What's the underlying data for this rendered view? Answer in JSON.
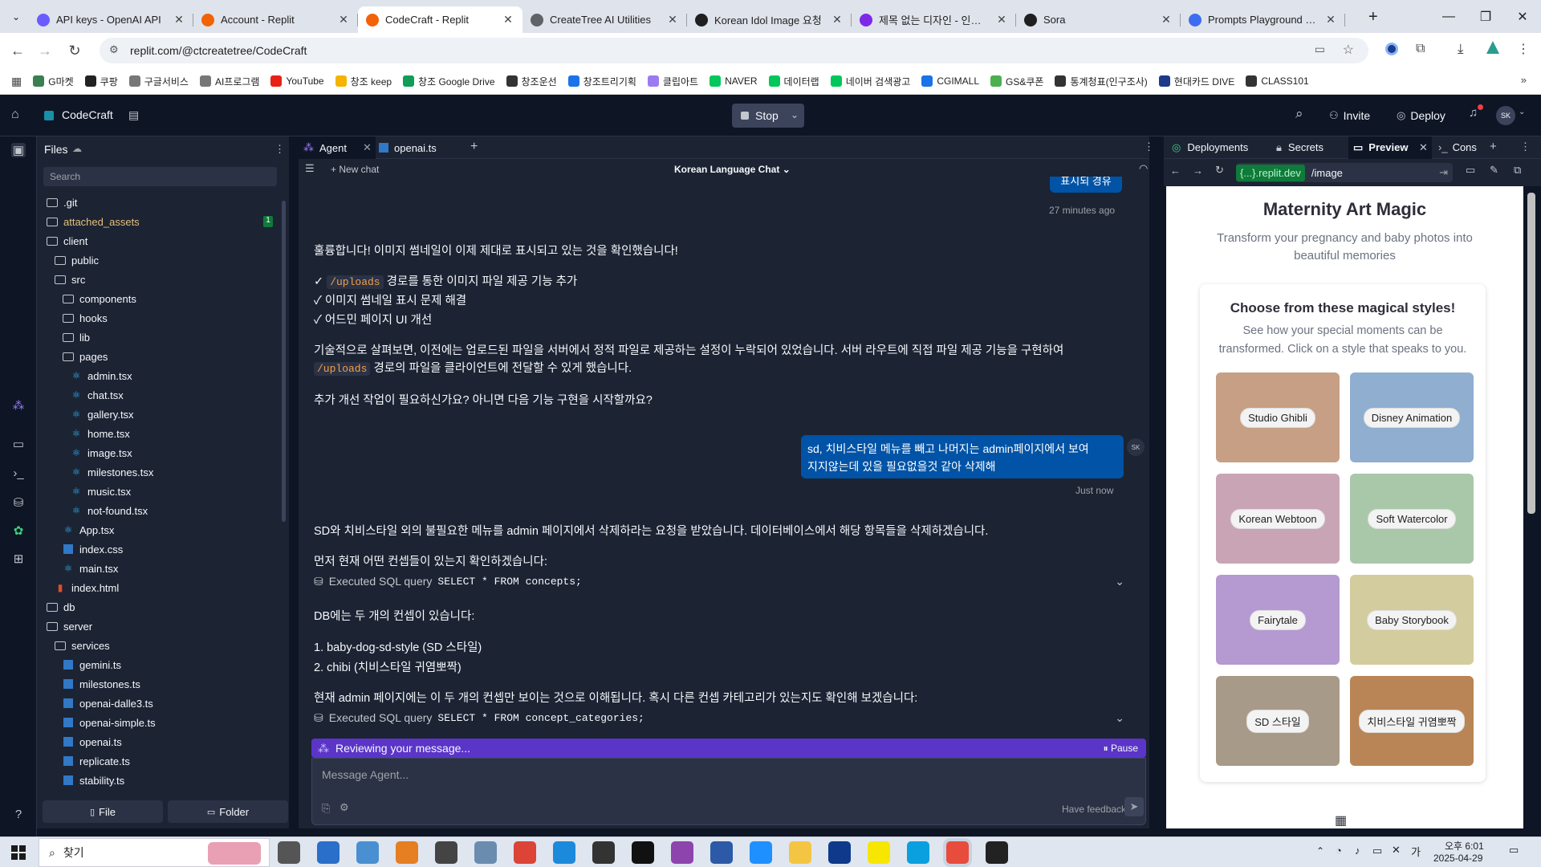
{
  "browser": {
    "tabs": [
      {
        "title": "API keys - OpenAI API",
        "color": "#6b5cff",
        "active": false
      },
      {
        "title": "Account - Replit",
        "color": "#f26207",
        "active": false
      },
      {
        "title": "CodeCraft - Replit",
        "color": "#f26207",
        "active": true
      },
      {
        "title": "CreateTree AI Utilities",
        "color": "#5f6368",
        "active": false
      },
      {
        "title": "Korean Idol Image 요청",
        "color": "#1f1f1f",
        "active": false
      },
      {
        "title": "제목 없는 디자인 - 인스타",
        "color": "#7d2ae8",
        "active": false
      },
      {
        "title": "Sora",
        "color": "#1f1f1f",
        "active": false
      },
      {
        "title": "Prompts Playground - Op",
        "color": "#3c6df0",
        "active": false
      }
    ],
    "url": "replit.com/@ctcreatetree/CodeCraft",
    "bookmarks": [
      "G마켓",
      "쿠팡",
      "구글서비스",
      "AI프로그램",
      "YouTube",
      "창조 keep",
      "창조 Google Drive",
      "창조운선",
      "창조트리기획",
      "클립아트",
      "NAVER",
      "데이터랩",
      "네이버 검색광고",
      "CGIMALL",
      "GS&쿠폰",
      "통계청표(인구조사)",
      "현대카드 DIVE",
      "CLASS101"
    ]
  },
  "replit": {
    "project": "CodeCraft",
    "stop_label": "Stop",
    "invite_label": "Invite",
    "deploy_label": "Deploy",
    "avatar": "SK"
  },
  "files": {
    "title": "Files",
    "search_placeholder": "Search",
    "items": [
      {
        "name": ".git",
        "type": "folder",
        "depth": 0
      },
      {
        "name": "attached_assets",
        "type": "folder",
        "depth": 0,
        "badge": "1",
        "highlight": true
      },
      {
        "name": "client",
        "type": "folder",
        "depth": 0
      },
      {
        "name": "public",
        "type": "folder",
        "depth": 1
      },
      {
        "name": "src",
        "type": "folder",
        "depth": 1
      },
      {
        "name": "components",
        "type": "folder",
        "depth": 2
      },
      {
        "name": "hooks",
        "type": "folder",
        "depth": 2
      },
      {
        "name": "lib",
        "type": "folder",
        "depth": 2
      },
      {
        "name": "pages",
        "type": "folder",
        "depth": 2
      },
      {
        "name": "admin.tsx",
        "type": "tsx",
        "depth": 3
      },
      {
        "name": "chat.tsx",
        "type": "tsx",
        "depth": 3
      },
      {
        "name": "gallery.tsx",
        "type": "tsx",
        "depth": 3
      },
      {
        "name": "home.tsx",
        "type": "tsx",
        "depth": 3
      },
      {
        "name": "image.tsx",
        "type": "tsx",
        "depth": 3
      },
      {
        "name": "milestones.tsx",
        "type": "tsx",
        "depth": 3
      },
      {
        "name": "music.tsx",
        "type": "tsx",
        "depth": 3
      },
      {
        "name": "not-found.tsx",
        "type": "tsx",
        "depth": 3
      },
      {
        "name": "App.tsx",
        "type": "tsx",
        "depth": 2
      },
      {
        "name": "index.css",
        "type": "css",
        "depth": 2
      },
      {
        "name": "main.tsx",
        "type": "tsx",
        "depth": 2
      },
      {
        "name": "index.html",
        "type": "html",
        "depth": 1
      },
      {
        "name": "db",
        "type": "folder",
        "depth": 0
      },
      {
        "name": "server",
        "type": "folder",
        "depth": 0
      },
      {
        "name": "services",
        "type": "folder",
        "depth": 1
      },
      {
        "name": "gemini.ts",
        "type": "ts",
        "depth": 2
      },
      {
        "name": "milestones.ts",
        "type": "ts",
        "depth": 2
      },
      {
        "name": "openai-dalle3.ts",
        "type": "ts",
        "depth": 2
      },
      {
        "name": "openai-simple.ts",
        "type": "ts",
        "depth": 2
      },
      {
        "name": "openai.ts",
        "type": "ts",
        "depth": 2
      },
      {
        "name": "replicate.ts",
        "type": "ts",
        "depth": 2
      },
      {
        "name": "stability.ts",
        "type": "ts",
        "depth": 2
      }
    ],
    "file_button": "File",
    "folder_button": "Folder"
  },
  "editor": {
    "tabs": [
      "Agent",
      "openai.ts"
    ],
    "new_chat": "New chat",
    "chat_title": "Korean Language Chat",
    "chat": {
      "prev_bubble": "표시되 경유",
      "time1": "27 minutes ago",
      "p1": "훌륭합니다! 이미지 썸네일이 이제 제대로 표시되고 있는 것을 확인했습니다!",
      "c1_code": "/uploads",
      "c1_rest": " 경로를 통한 이미지 파일 제공 기능 추가",
      "c2": "✓ 이미지 썸네일 표시 문제 해결",
      "c3": "✓ 어드민 페이지 UI 개선",
      "p2a": "기술적으로 살펴보면, 이전에는 업로드된 파일을 서버에서 정적 파일로 제공하는 설정이 누락되어 있었습니다. 서버 라우트에 직접 파일 제공 기능을 구현하여",
      "p2_code": "/uploads",
      "p2b": " 경로의 파일을 클라이언트에 전달할 수 있게 했습니다.",
      "p3": "추가 개선 작업이 필요하신가요? 아니면 다음 기능 구현을 시작할까요?",
      "user_msg_1": "sd, 치비스타일 메뉴를 빼고 나머지는 admin페이지에서 보여",
      "user_msg_2": "지지않는데 있을 필요없을것 같아 삭제해",
      "user_avatar": "SK",
      "time2": "Just now",
      "p4": "SD와 치비스타일 외의 불필요한 메뉴를 admin 페이지에서 삭제하라는 요청을 받았습니다. 데이터베이스에서 해당 항목들을 삭제하겠습니다.",
      "p5": "먼저 현재 어떤 컨셉들이 있는지 확인하겠습니다:",
      "sql1_label": "Executed SQL query",
      "sql1": "SELECT * FROM concepts;",
      "p6": "DB에는 두 개의 컨셉이 있습니다:",
      "li1": "1. baby-dog-sd-style (SD 스타일)",
      "li2": "2. chibi (치비스타일 귀염뽀짝)",
      "p7": "현재 admin 페이지에는 이 두 개의 컨셉만 보이는 것으로 이해됩니다. 혹시 다른 컨셉 카테고리가 있는지도 확인해 보겠습니다:",
      "sql2_label": "Executed SQL query",
      "sql2": "SELECT * FROM concept_categories;",
      "status": "Reviewing your message...",
      "pause": "Pause",
      "input_placeholder": "Message Agent...",
      "feedback": "Have feedback?"
    }
  },
  "right_panel": {
    "tabs": [
      "Deployments",
      "Secrets",
      "Preview",
      "Cons"
    ],
    "url_host": "{...}.replit.dev",
    "url_path": "/image",
    "preview": {
      "title": "Maternity Art Magic",
      "subtitle_1": "Transform your pregnancy and baby photos into",
      "subtitle_2": "beautiful memories",
      "section_title": "Choose from these magical styles!",
      "section_desc_1": "See how your special moments can be",
      "section_desc_2": "transformed. Click on a style that speaks to you.",
      "styles": [
        {
          "label": "Studio Ghibli",
          "bg": "#c79f84"
        },
        {
          "label": "Disney Animation",
          "bg": "#8faed0"
        },
        {
          "label": "Korean Webtoon",
          "bg": "#c9a4b4"
        },
        {
          "label": "Soft Watercolor",
          "bg": "#a9c8aa"
        },
        {
          "label": "Fairytale",
          "bg": "#b49ad0"
        },
        {
          "label": "Baby Storybook",
          "bg": "#d3cc9e"
        },
        {
          "label": "SD 스타일",
          "bg": "#a89a88"
        },
        {
          "label": "치비스타일 귀염뽀짝",
          "bg": "#b98556"
        }
      ]
    }
  },
  "taskbar": {
    "search": "찾기",
    "time": "오후 6:01",
    "date": "2025-04-29"
  }
}
